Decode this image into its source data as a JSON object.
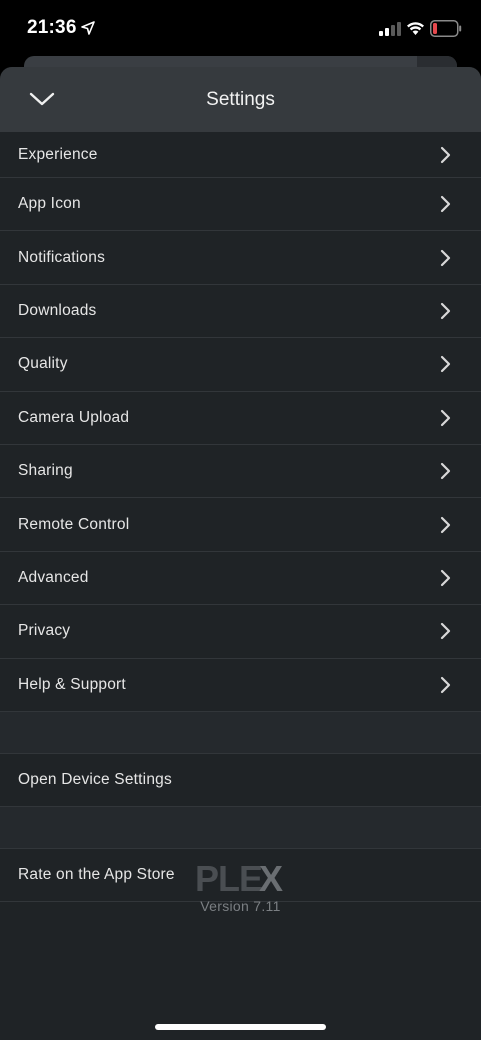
{
  "status_bar": {
    "time": "21:36",
    "icons": [
      "location-arrow-icon",
      "cellular-signal-icon",
      "wifi-icon",
      "battery-low-icon"
    ],
    "battery_color": "#e5484d"
  },
  "header": {
    "title": "Settings",
    "collapse_icon": "chevron-down-icon"
  },
  "menu_items": [
    {
      "label": "Experience"
    },
    {
      "label": "App Icon"
    },
    {
      "label": "Notifications"
    },
    {
      "label": "Downloads"
    },
    {
      "label": "Quality"
    },
    {
      "label": "Camera Upload"
    },
    {
      "label": "Sharing"
    },
    {
      "label": "Remote Control"
    },
    {
      "label": "Advanced"
    },
    {
      "label": "Privacy"
    },
    {
      "label": "Help & Support"
    }
  ],
  "actions": {
    "open_device_settings": "Open Device Settings",
    "rate_app_store": "Rate on the App Store"
  },
  "footer": {
    "logo_text": "PLEX",
    "version": "Version 7.11"
  },
  "colors": {
    "background": "#1f2326",
    "header": "#363a3e",
    "divider": "#32363a",
    "logo_gray": "#4a4e52",
    "logo_x_accent": "#6a6e72"
  }
}
